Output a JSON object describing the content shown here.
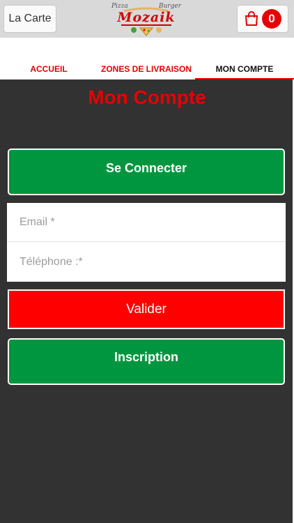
{
  "header": {
    "menu_label": "La Carte",
    "cart_count": "0",
    "logo": {
      "left_text": "Pizza",
      "right_text": "Burger",
      "name": "Mozaik"
    }
  },
  "tabs": [
    {
      "label": "ACCUEIL",
      "active": false
    },
    {
      "label": "ZONES DE LIVRAISON",
      "active": false
    },
    {
      "label": "MON COMPTE",
      "active": true
    }
  ],
  "main": {
    "title": "Mon Compte",
    "connect_label": "Se Connecter",
    "email_placeholder": "Email *",
    "phone_placeholder": "Téléphone :*",
    "validate_label": "Valider",
    "inscription_label": "Inscription"
  },
  "colors": {
    "accent": "#e60000",
    "green": "#00963f",
    "dark_bg": "#323232",
    "validate_red": "#ff0000"
  }
}
